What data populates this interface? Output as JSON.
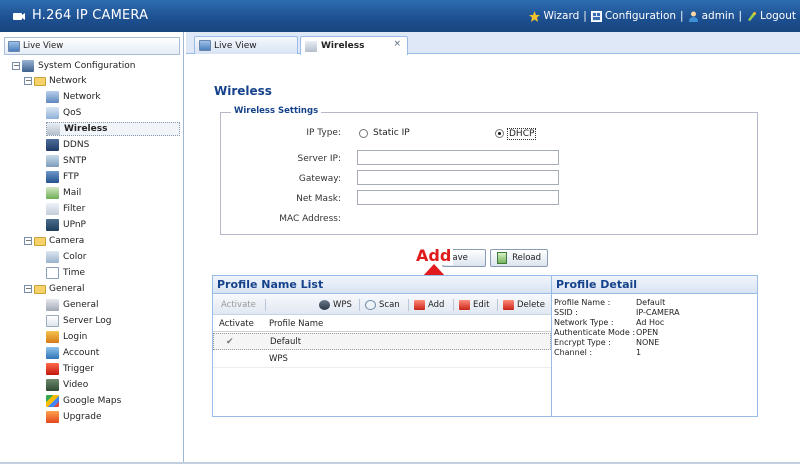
{
  "header": {
    "title": "H.264 IP CAMERA",
    "nav": [
      {
        "label": "Wizard",
        "icon": "wizard-icon"
      },
      {
        "label": "Configuration",
        "icon": "configuration-icon"
      },
      {
        "label": "admin",
        "icon": "user-icon"
      },
      {
        "label": "Logout",
        "icon": "logout-icon"
      }
    ]
  },
  "left": {
    "tab_label": "Live View",
    "tree": {
      "root": "System Configuration",
      "network": "Network",
      "network_items": [
        "Network",
        "QoS",
        "Wireless",
        "DDNS",
        "SNTP",
        "FTP",
        "Mail",
        "Filter",
        "UPnP"
      ],
      "camera": "Camera",
      "camera_items": [
        "Color",
        "Time"
      ],
      "general": "General",
      "general_items": [
        "General",
        "Server Log",
        "Login",
        "Account",
        "Trigger",
        "Video",
        "Google Maps",
        "Upgrade"
      ]
    }
  },
  "tabs": [
    {
      "label": "Live View"
    },
    {
      "label": "Wireless",
      "close": "×"
    }
  ],
  "wireless": {
    "title": "Wireless",
    "legend": "Wireless Settings",
    "ip_type_label": "IP Type:",
    "static_ip": "Static IP",
    "dhcp": "DHCP",
    "ip_type_selected": "DHCP",
    "server_ip_label": "Server IP:",
    "gateway_label": "Gateway:",
    "netmask_label": "Net Mask:",
    "mac_label": "MAC Address:",
    "server_ip": "",
    "gateway": "",
    "netmask": "",
    "mac": "",
    "save_label": "Save",
    "reload_label": "Reload",
    "annotation": "Add"
  },
  "profile_list": {
    "title": "Profile Name List",
    "toolbar": [
      "Activate",
      "WPS",
      "Scan",
      "Add",
      "Edit",
      "Delete"
    ],
    "columns": [
      "Activate",
      "Profile Name"
    ],
    "rows": [
      {
        "activate": "✔",
        "name": "Default"
      },
      {
        "activate": "",
        "name": "WPS"
      }
    ]
  },
  "profile_detail": {
    "title": "Profile Detail",
    "rows": [
      {
        "key": "Profile Name :",
        "value": "Default"
      },
      {
        "key": "SSID :",
        "value": "IP-CAMERA"
      },
      {
        "key": "Network Type :",
        "value": "Ad Hoc"
      },
      {
        "key": "Authenticate Mode :",
        "value": "OPEN"
      },
      {
        "key": "Encrypt Type :",
        "value": "NONE"
      },
      {
        "key": "Channel :",
        "value": "1"
      }
    ]
  },
  "colors": {
    "header_bg": "#1d4f8f",
    "accent_text": "#15428b",
    "annotation_red": "#e11b1b"
  }
}
